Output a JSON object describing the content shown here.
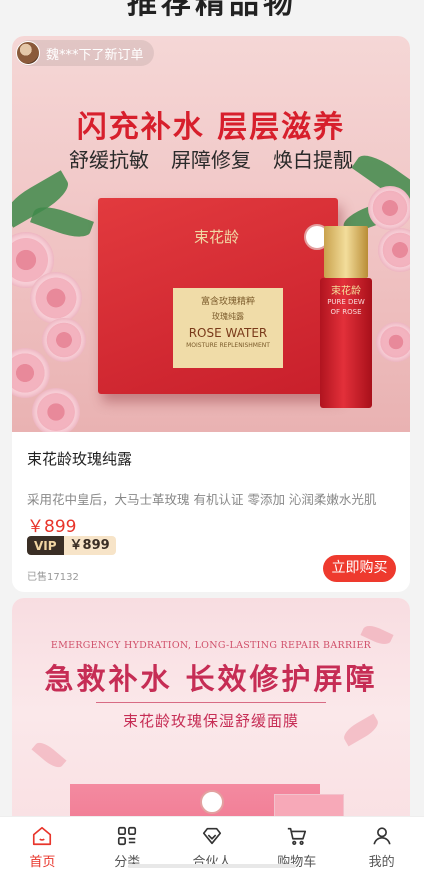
{
  "section": {
    "title": "推荐精品物"
  },
  "notice": {
    "text": "魏***下了新订单"
  },
  "product1": {
    "banner": {
      "slogan": "闪充补水 层层滋养",
      "features": [
        "舒缓抗敏",
        "屏障修复",
        "焕白提靓"
      ],
      "box_brand": "束花龄",
      "box_line1": "富含玫瑰精粹",
      "box_line2": "玫瑰纯露",
      "box_line3": "ROSE WATER",
      "box_line4": "MOISTURE REPLENISHMENT",
      "bottle_brand": "束花龄",
      "bottle_label": "PURE DEW OF ROSE"
    },
    "name": "束花龄玫瑰纯露",
    "desc": "采用花中皇后，大马士革玫瑰 有机认证 零添加 沁润柔嫩水光肌",
    "price": "￥899",
    "vip_tag": "VIP",
    "vip_price": "￥899",
    "sold": "已售17132",
    "buy_label": "立即购买"
  },
  "product2": {
    "banner": {
      "en": "EMERGENCY HYDRATION, LONG-LASTING REPAIR BARRIER",
      "slogan": "急救补水 长效修护屏障",
      "sub": "束花龄玫瑰保湿舒缓面膜"
    }
  },
  "tabbar": {
    "items": [
      {
        "label": "首页",
        "icon": "home-icon",
        "active": true
      },
      {
        "label": "分类",
        "icon": "category-icon",
        "active": false
      },
      {
        "label": "合伙人",
        "icon": "diamond-icon",
        "active": false
      },
      {
        "label": "购物车",
        "icon": "cart-icon",
        "active": false
      },
      {
        "label": "我的",
        "icon": "user-icon",
        "active": false
      }
    ]
  },
  "colors": {
    "accent": "#e8352b",
    "vip_dark": "#3a2e25",
    "vip_light": "#f7e4c8"
  }
}
